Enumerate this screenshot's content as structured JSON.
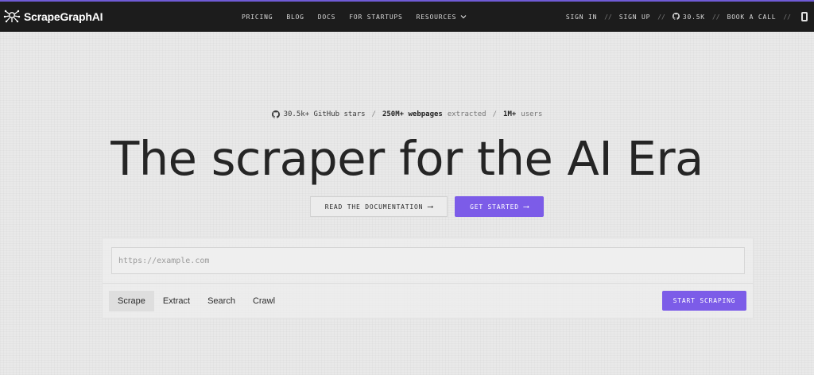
{
  "brand": {
    "name": "ScrapeGraphAI"
  },
  "nav": {
    "links": [
      "PRICING",
      "BLOG",
      "DOCS",
      "FOR STARTUPS",
      "RESOURCES"
    ],
    "right": {
      "sign_in": "SIGN IN",
      "sign_up": "SIGN UP",
      "stars": "30.5K",
      "book_call": "BOOK A CALL",
      "separator": "//"
    }
  },
  "stats": {
    "github": "30.5k+ GitHub stars",
    "pages_bold": "250M+ webpages",
    "pages_muted": "extracted",
    "users_bold": "1M+",
    "users_muted": "users",
    "separator": "/"
  },
  "hero": {
    "headline": "The scraper for the AI Era"
  },
  "cta": {
    "docs": "READ THE DOCUMENTATION",
    "start": "GET STARTED",
    "arrow": "⟶"
  },
  "scraper": {
    "placeholder": "https://example.com",
    "value": "",
    "tabs": [
      "Scrape",
      "Extract",
      "Search",
      "Crawl"
    ],
    "active_tab": "Scrape",
    "submit": "START SCRAPING"
  },
  "colors": {
    "accent": "#7c5ce8",
    "nav_bg": "#1c1c1c",
    "page_bg": "#e9e9e9"
  },
  "icons": {
    "logo": "spider-graph-icon",
    "github": "github-icon",
    "chevron": "chevron-down-icon",
    "arrow": "arrow-right-icon"
  }
}
